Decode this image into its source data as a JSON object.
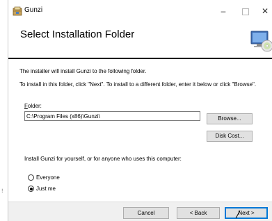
{
  "window": {
    "title": "Gunzi",
    "minimize_glyph": "–",
    "close_glyph": "✕"
  },
  "header": {
    "title": "Select Installation Folder"
  },
  "body": {
    "line1": "The installer will install Gunzi to the following folder.",
    "line2": "To install in this folder, click \"Next\". To install to a different folder, enter it below or click \"Browse\".",
    "folder_label_access": "F",
    "folder_label_rest": "older:",
    "folder_value": "C:\\Program Files (x86)\\Gunzi\\",
    "browse_label": "Browse...",
    "disk_cost_label": "Disk Cost...",
    "install_for_label": "Install Gunzi for yourself, or for anyone who uses this computer:",
    "radios": [
      {
        "label": "Everyone",
        "checked": false
      },
      {
        "label": "Just me",
        "checked": true
      }
    ]
  },
  "footer": {
    "cancel_label": "Cancel",
    "back_label": "< Back",
    "next_label": "Next >"
  },
  "colors": {
    "accent": "#0078d7",
    "button_face": "#e1e1e1",
    "footer_bg": "#f0f0f0"
  },
  "icons": {
    "app": "installer-box-icon",
    "header_art": "computer-cd-icon",
    "cursor": "mouse-pointer-icon"
  }
}
